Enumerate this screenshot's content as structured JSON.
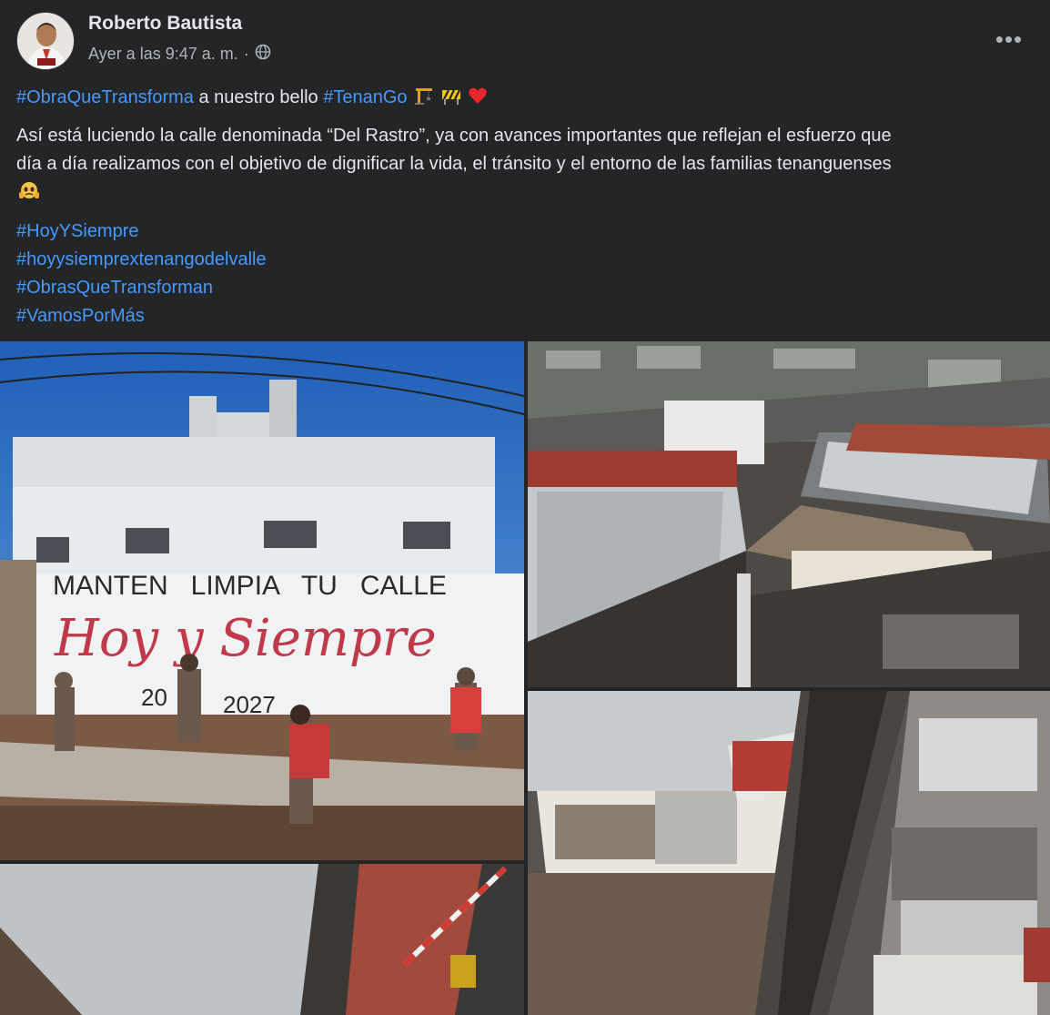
{
  "post": {
    "author": "Roberto Bautista",
    "timestamp": "Ayer a las 9:47 a. m.",
    "separator": "·",
    "privacy_icon": "globe-icon",
    "more_label": "•••",
    "headline": {
      "tag1": "#ObraQueTransforma",
      "middle": " a nuestro bello ",
      "tag2": "#TenanGo",
      "emojis": [
        "crane-emoji",
        "construction-emoji",
        "red-heart-emoji"
      ]
    },
    "body_line1": "Así está luciendo la calle denominada “Del Rastro”, ya con avances importantes que reflejan el esfuerzo que",
    "body_line2": "día a día realizamos con el objetivo de dignificar la vida, el tránsito y el entorno de las familias tenanguenses",
    "body_emoji": "face-holding-back-tears-emoji",
    "hashtags": [
      "#HoyYSiempre",
      "#hoyysiemprextenangodelvalle",
      "#ObrasQueTransforman",
      "#VamosPorMás"
    ]
  },
  "photos": {
    "wall_text_1": "MANTEN   LIMPIA   TU   CALLE",
    "wall_text_2": "Hoy y Siempre",
    "wall_years_a": "20",
    "wall_years_b": "2027",
    "colors": {
      "link": "#4599ff",
      "background": "#242526",
      "text": "#e4e6eb",
      "secondary": "#b0b3b8"
    }
  }
}
